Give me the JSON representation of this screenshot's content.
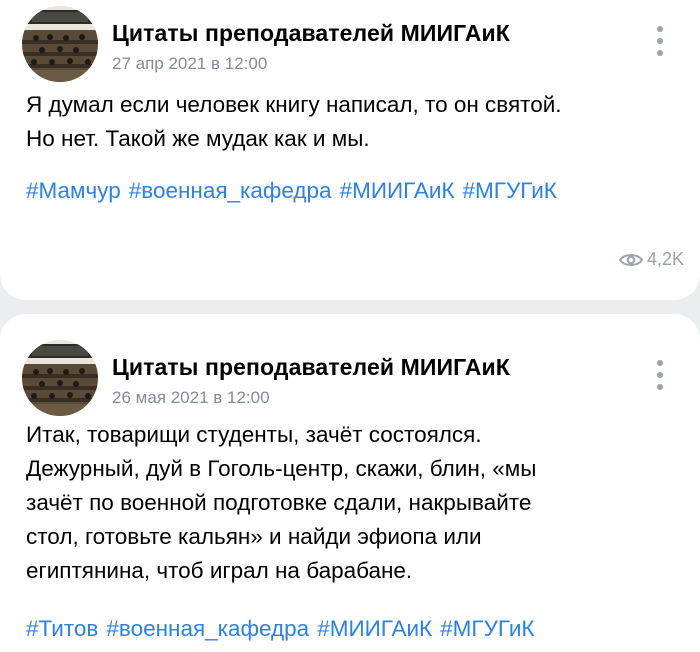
{
  "posts": [
    {
      "author": "Цитаты преподавателей МИИГАиК",
      "date": "27 апр 2021 в 12:00",
      "lines": [
        "Я думал если человек книгу написал, то он святой.",
        "Но нет. Такой же мудак как и мы."
      ],
      "tags": [
        "#Мамчур",
        "#военная_кафедра",
        "#МИИГАиК",
        "#МГУГиК"
      ],
      "views": "4,2K",
      "avatar_icon": "lecture-hall-photo",
      "menu_icon": "more-vertical-icon"
    },
    {
      "author": "Цитаты преподавателей МИИГАиК",
      "date": "26 мая 2021 в 12:00",
      "lines": [
        "Итак, товарищи студенты, зачёт состоялся.",
        "Дежурный, дуй в Гоголь-центр, скажи, блин, «мы",
        "зачёт по военной подготовке сдали, накрывайте",
        "стол, готовьте кальян» и найди эфиопа или",
        "египтянина, чтоб играл на барабане."
      ],
      "tags": [
        "#Титов",
        "#военная_кафедра",
        "#МИИГАиК",
        "#МГУГиК"
      ],
      "avatar_icon": "lecture-hall-photo",
      "menu_icon": "more-vertical-icon"
    }
  ],
  "colors": {
    "background": "#ebedf0",
    "link": "#2d81e0",
    "secondary_text": "#818c99"
  }
}
